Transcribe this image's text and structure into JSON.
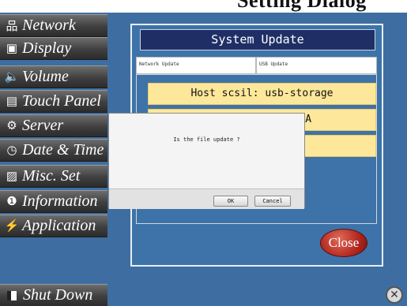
{
  "header": {
    "cut_title": "Setting Dialog"
  },
  "sidebar": {
    "items": [
      {
        "label": "Network",
        "icon": "network-icon",
        "glyph": "品"
      },
      {
        "label": "Display",
        "icon": "display-icon",
        "glyph": "▣"
      },
      {
        "label": "Volume",
        "icon": "speaker-icon",
        "glyph": "🔈"
      },
      {
        "label": "Touch Panel",
        "icon": "touch-panel-icon",
        "glyph": "▤"
      },
      {
        "label": "Server",
        "icon": "gear-icon",
        "glyph": "⚙"
      },
      {
        "label": "Date & Time",
        "icon": "clock-icon",
        "glyph": "◷"
      },
      {
        "label": "Misc. Set",
        "icon": "misc-icon",
        "glyph": "▨"
      },
      {
        "label": "Information",
        "icon": "info-icon",
        "glyph": "❶"
      },
      {
        "label": "Application",
        "icon": "lightning-icon",
        "glyph": "⚡"
      }
    ],
    "shutdown_label": "Shut Down"
  },
  "panel": {
    "title": "System Update",
    "tabs": [
      {
        "label": "Network Update"
      },
      {
        "label": "USB Update"
      }
    ],
    "rows": [
      {
        "text": "Host scsil: usb-storage"
      },
      {
        "text": "Vendor: HAGIWARA"
      },
      {
        "text": ""
      }
    ],
    "close_label": "Close"
  },
  "dialog": {
    "message": "Is the file update ?",
    "ok_label": "OK",
    "cancel_label": "Cancel"
  },
  "corner_close": {
    "glyph": "✕"
  },
  "colors": {
    "background": "#3e6ea1",
    "title_bar": "#1f2f66",
    "row_fill": "#fde79a",
    "close_button": "#b2271f"
  }
}
